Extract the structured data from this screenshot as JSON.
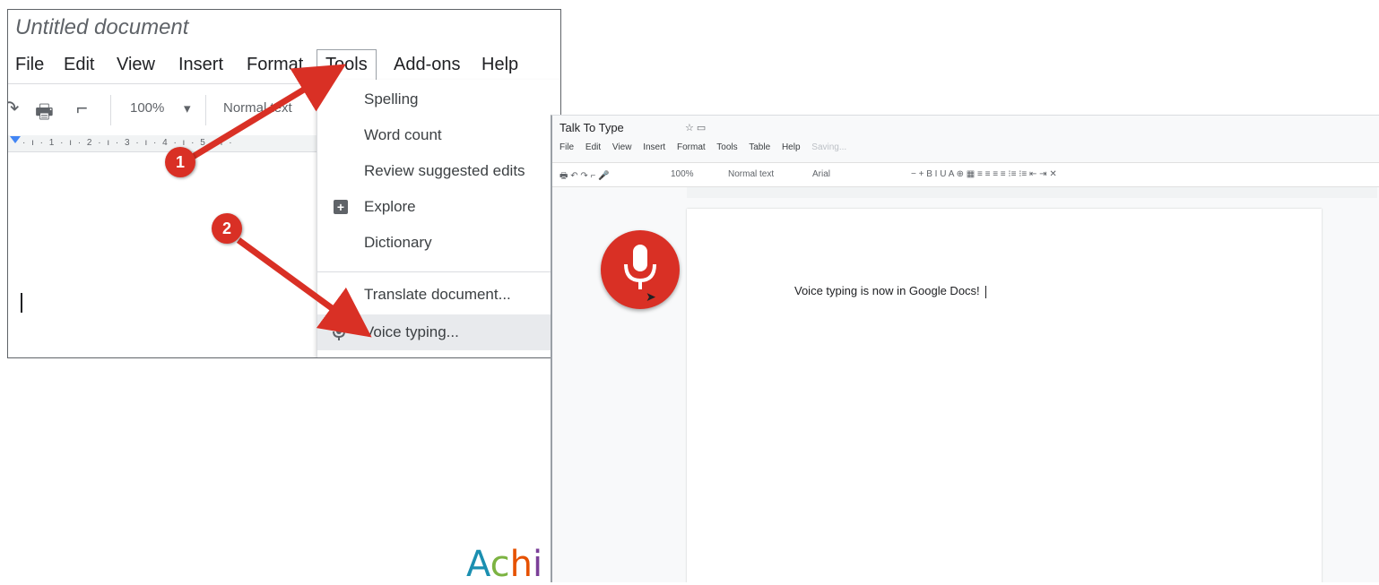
{
  "left_shot": {
    "doc_title": "Untitled document",
    "menu": [
      "File",
      "Edit",
      "View",
      "Insert",
      "Format",
      "Tools",
      "Add-ons",
      "Help"
    ],
    "toolbar": {
      "zoom": "100%",
      "zoom_arrow": "▾",
      "style": "Normal text"
    },
    "ruler": "· ı · 1 · ı · 2 · ı · 3 · ı · 4 · ı · 5 · ı ·",
    "tools_menu": {
      "spelling": "Spelling",
      "word_count": "Word count",
      "review": "Review suggested edits",
      "explore": "Explore",
      "dictionary": "Dictionary",
      "translate": "Translate document...",
      "voice_typing": "Voice typing..."
    },
    "badges": [
      "1",
      "2"
    ],
    "accent_color": "#d93025"
  },
  "right_shot": {
    "doc_title": "Talk To Type",
    "title_icons": "☆ ▭",
    "menu": [
      "File",
      "Edit",
      "View",
      "Insert",
      "Format",
      "Tools",
      "Table",
      "Help"
    ],
    "menu_faint": "Saving...",
    "toolbar": {
      "zoom": "100%",
      "style": "Normal text",
      "font": "Arial"
    },
    "page_text": "Voice typing is now in Google Docs!",
    "mic_color": "#d93025"
  },
  "logo": {
    "a": "A",
    "c": "c",
    "h": "h",
    "i": "i"
  }
}
